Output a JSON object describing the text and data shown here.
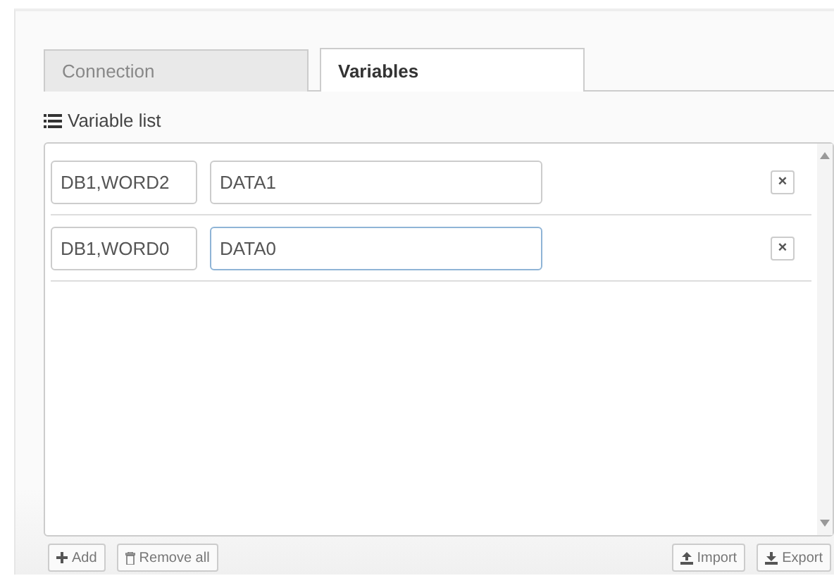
{
  "tabs": [
    {
      "label": "Connection",
      "selected": false
    },
    {
      "label": "Variables",
      "selected": true
    }
  ],
  "list_title": "Variable list",
  "variables": [
    {
      "address": "DB1,WORD2",
      "name": "DATA1",
      "focused": false,
      "delete": "×"
    },
    {
      "address": "DB1,WORD0",
      "name": "DATA0",
      "focused": true,
      "delete": "×"
    }
  ],
  "left_buttons": [
    {
      "label": "Add",
      "kind": "add"
    },
    {
      "label": "Remove all",
      "kind": "trash"
    }
  ],
  "right_buttons": [
    {
      "label": "Import",
      "kind": "upload"
    },
    {
      "label": "Export",
      "kind": "download"
    }
  ]
}
